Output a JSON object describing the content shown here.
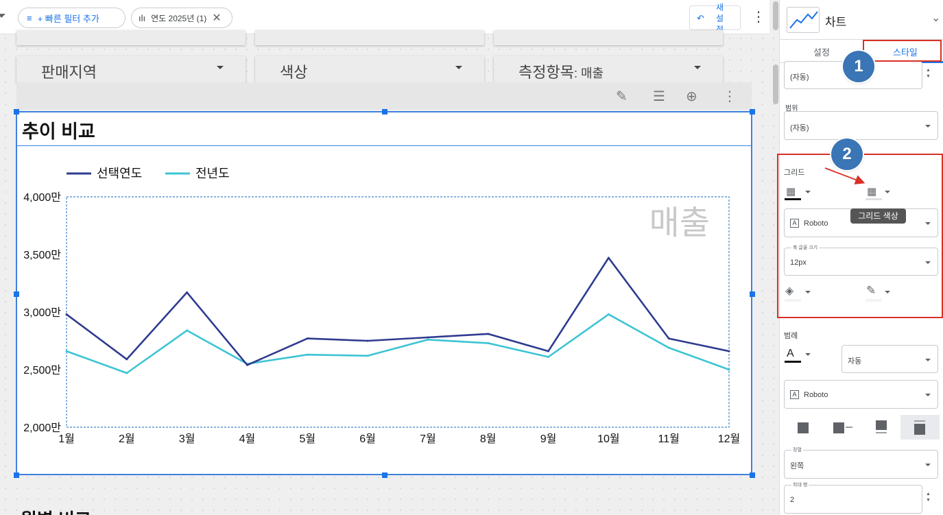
{
  "filter_bar": {
    "add_filter_label": "+ 빠른 필터 추가",
    "year_chip_label": "연도 2025년 (1)",
    "reset_label": "새 설정"
  },
  "controls": [
    {
      "label": "판매지역",
      "suffix": ""
    },
    {
      "label": "색상",
      "suffix": ""
    },
    {
      "label": "측정항목",
      "suffix": ": 매출"
    }
  ],
  "chart": {
    "title": "추이 비교",
    "watermark": "매출"
  },
  "below_title": "월별 비교",
  "chart_data": {
    "type": "line",
    "categories": [
      "1월",
      "2월",
      "3월",
      "4월",
      "5월",
      "6월",
      "7월",
      "8월",
      "9월",
      "10월",
      "11월",
      "12월"
    ],
    "series": [
      {
        "name": "선택연도",
        "color": "#2e3b8f",
        "values": [
          29800000,
          25900000,
          31700000,
          25400000,
          27700000,
          27500000,
          27800000,
          28100000,
          26600000,
          34700000,
          27700000,
          26600000
        ]
      },
      {
        "name": "전년도",
        "color": "#3cc4d4",
        "values": [
          26600000,
          24700000,
          28400000,
          25500000,
          26300000,
          26200000,
          27600000,
          27300000,
          26100000,
          29800000,
          26900000,
          25000000
        ]
      }
    ],
    "y_ticks": [
      "4,000만",
      "3,500만",
      "3,000만",
      "2,500만",
      "2,000만"
    ],
    "ylim": [
      20000000,
      40000000
    ]
  },
  "panel": {
    "title": "차트",
    "tab_setup": "설정",
    "tab_style": "스타일",
    "auto_value": "(자동)",
    "range_label": "범위",
    "range_value": "(자동)",
    "grid_label": "그리드",
    "grid_tooltip": "그리드 색상",
    "font_value": "Roboto",
    "axis_font_size_label": "축 글꼴 크기",
    "axis_font_size_value": "12px",
    "legend_label": "범례",
    "legend_auto": "자동",
    "legend_font_value": "Roboto",
    "align_label": "정렬",
    "align_value": "왼쪽",
    "max_lines_label": "최대 행",
    "max_lines_value": "2",
    "badge1": "1",
    "badge2": "2"
  }
}
